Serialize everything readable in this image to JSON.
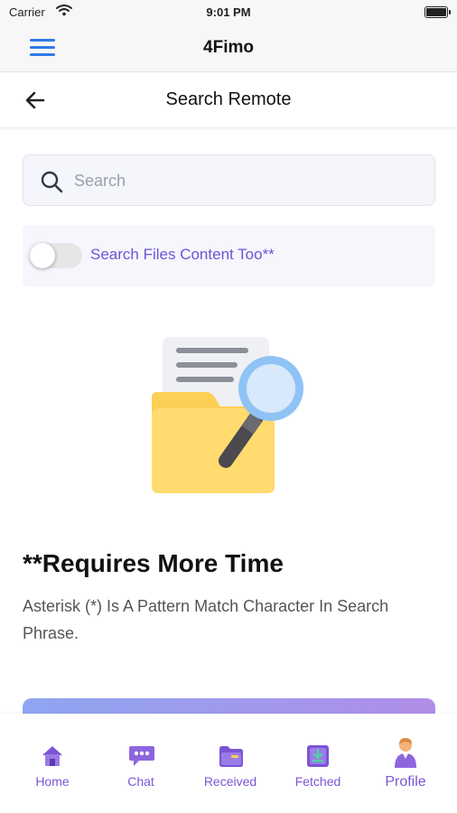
{
  "status_bar": {
    "carrier": "Carrier",
    "time": "9:01 PM"
  },
  "app_bar": {
    "title": "4Fimo"
  },
  "page_header": {
    "title": "Search Remote"
  },
  "search": {
    "placeholder": "Search",
    "value": ""
  },
  "toggle": {
    "label": "Search Files Content Too**",
    "on": false
  },
  "illustration": {
    "name": "folder-search-illustration"
  },
  "info": {
    "heading": "**Requires More Time",
    "text": "Asterisk (*) Is A Pattern Match Character In Search Phrase."
  },
  "tabs": [
    {
      "label": "Home",
      "icon": "home-icon"
    },
    {
      "label": "Chat",
      "icon": "chat-icon"
    },
    {
      "label": "Received",
      "icon": "received-icon"
    },
    {
      "label": "Fetched",
      "icon": "fetched-icon"
    },
    {
      "label": "Profile",
      "icon": "profile-icon",
      "active": true
    }
  ],
  "colors": {
    "accent": "#7b54d6",
    "menu_blue": "#2f7be5",
    "folder_yellow": "#ffd96a",
    "magnifier_blue": "#8fc3f5"
  }
}
